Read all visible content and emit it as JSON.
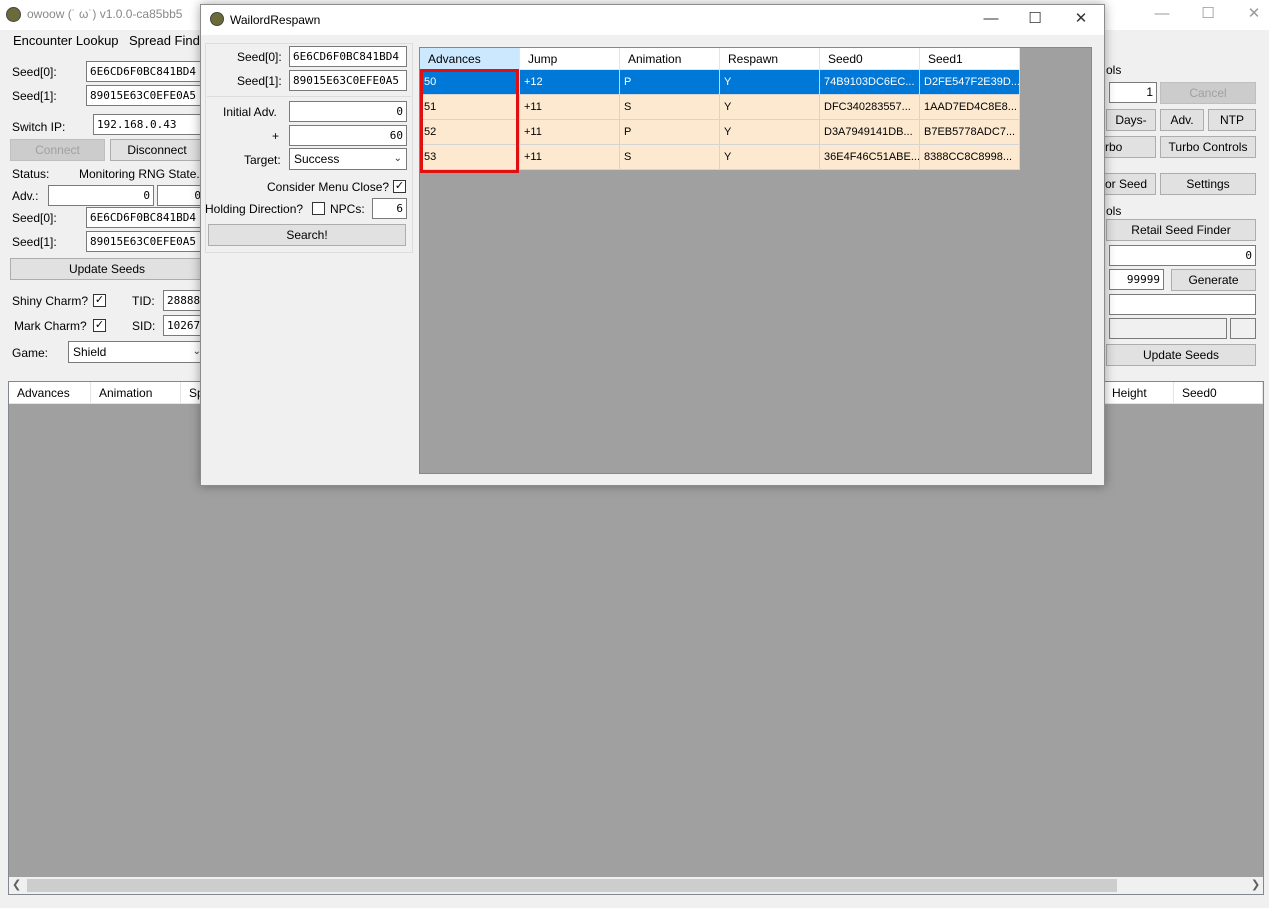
{
  "main": {
    "title": "owoow (˙ ω˙) v1.0.0-ca85bb5",
    "menu": [
      "Encounter Lookup",
      "Spread Finder"
    ],
    "seed0_label": "Seed[0]:",
    "seed1_label": "Seed[1]:",
    "seed0_value": "6E6CD6F0BC841BD4",
    "seed1_value": "89015E63C0EFE0A5",
    "switch_ip_label": "Switch IP:",
    "switch_ip_value": "192.168.0.43",
    "connect_label": "Connect",
    "disconnect_label": "Disconnect",
    "status_label": "Status:",
    "status_value": "Monitoring RNG State...",
    "adv_label": "Adv.:",
    "adv_value1": "0",
    "adv_value2": "0",
    "update_seeds_label": "Update Seeds",
    "shiny_charm_label": "Shiny Charm?",
    "mark_charm_label": "Mark Charm?",
    "tid_label": "TID:",
    "tid_value": "28888",
    "sid_label": "SID:",
    "sid_value": "10267",
    "game_label": "Game:",
    "game_value": "Shield",
    "right_panel": {
      "tools_label": "ols",
      "stepper_value": "1",
      "cancel_label": "Cancel",
      "days_label": "Days-",
      "adv_label": "Adv.",
      "ntp_label": "NTP",
      "turbo_label": "rbo",
      "turbo_controls_label": "Turbo Controls",
      "for_seed_label": "or Seed",
      "settings_label": "Settings",
      "tools2_label": "ols",
      "retail_seed_finder_label": "Retail Seed Finder",
      "min_value": "0",
      "max_value": "99999",
      "generate_label": "Generate",
      "update_seeds_label": "Update Seeds"
    },
    "grid_headers": [
      "Advances",
      "Animation",
      "Sp",
      "Height",
      "Seed0"
    ]
  },
  "dialog": {
    "title": "WailordRespawn",
    "seed0_label": "Seed[0]:",
    "seed1_label": "Seed[1]:",
    "seed0_value": "6E6CD6F0BC841BD4",
    "seed1_value": "89015E63C0EFE0A5",
    "initial_adv_label": "Initial Adv.",
    "initial_adv_value": "0",
    "plus_label": "+",
    "plus_value": "60",
    "target_label": "Target:",
    "target_value": "Success",
    "consider_menu_label": "Consider Menu Close?",
    "holding_direction_label": "Holding Direction?",
    "npcs_label": "NPCs:",
    "npcs_value": "6",
    "search_label": "Search!",
    "headers": [
      "Advances",
      "Jump",
      "Animation",
      "Respawn",
      "Seed0",
      "Seed1"
    ],
    "rows": [
      [
        "50",
        "+12",
        "P",
        "Y",
        "74B9103DC6EC...",
        "D2FE547F2E39D..."
      ],
      [
        "51",
        "+11",
        "S",
        "Y",
        "DFC340283557...",
        "1AAD7ED4C8E8..."
      ],
      [
        "52",
        "+11",
        "P",
        "Y",
        "D3A7949141DB...",
        "B7EB5778ADC7..."
      ],
      [
        "53",
        "+11",
        "S",
        "Y",
        "36E4F46C51ABE...",
        "8388CC8C8998..."
      ]
    ]
  },
  "colors": {
    "selection": "#0078d7",
    "row_background": "#fde9d0",
    "highlight_box": "#e01010",
    "grid_background": "#a0a0a0"
  }
}
